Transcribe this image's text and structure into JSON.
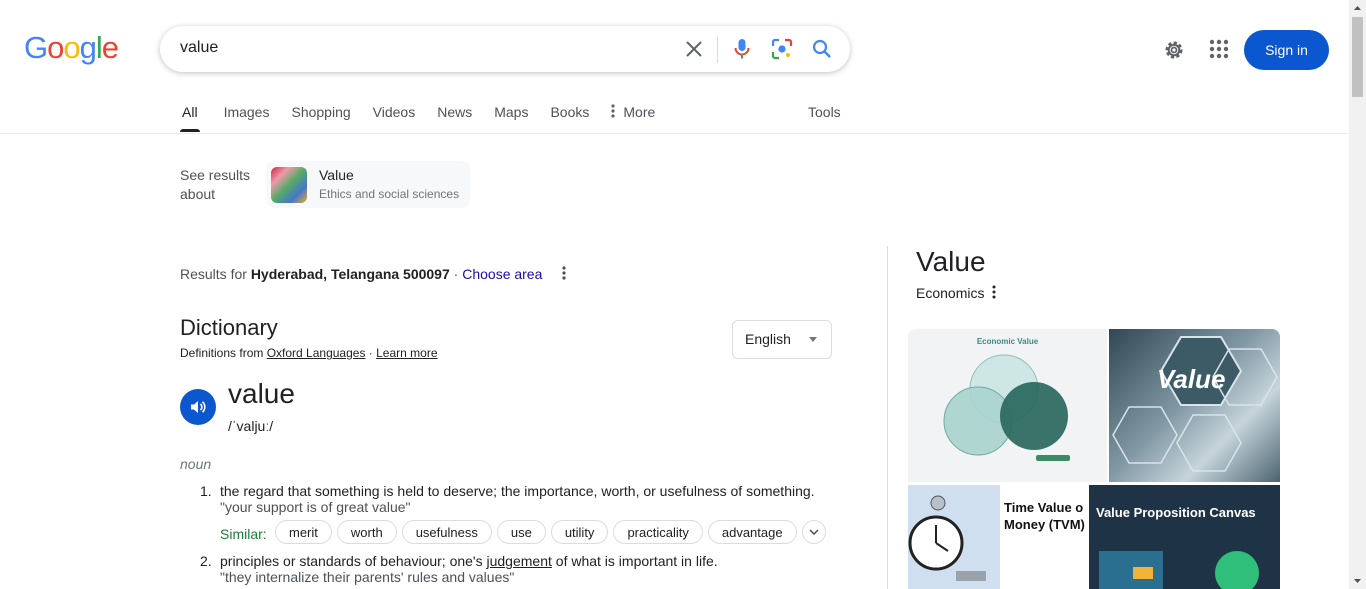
{
  "logo": {
    "letters": [
      "G",
      "o",
      "o",
      "g",
      "l",
      "e"
    ],
    "colors": [
      "#4285f4",
      "#ea4335",
      "#fbbc05",
      "#4285f4",
      "#34a853",
      "#ea4335"
    ]
  },
  "search": {
    "query": "value"
  },
  "header": {
    "signin_label": "Sign in"
  },
  "tabs": [
    {
      "label": "All",
      "active": true
    },
    {
      "label": "Images"
    },
    {
      "label": "Shopping"
    },
    {
      "label": "Videos"
    },
    {
      "label": "News"
    },
    {
      "label": "Maps"
    },
    {
      "label": "Books"
    },
    {
      "label": "More"
    }
  ],
  "tools_label": "Tools",
  "see_results": {
    "label_line1": "See results",
    "label_line2": "about",
    "card_title": "Value",
    "card_subtitle": "Ethics and social sciences"
  },
  "results_for": {
    "prefix": "Results for ",
    "location": "Hyderabad, Telangana 500097",
    "separator": " · ",
    "choose_area": "Choose area"
  },
  "dictionary": {
    "title": "Dictionary",
    "from_prefix": "Definitions from ",
    "source": "Oxford Languages",
    "sep": " · ",
    "learn_more": "Learn more",
    "language": "English",
    "word": "value",
    "phonetic": "/ˈvaljuː/",
    "part_of_speech": "noun",
    "definitions": [
      {
        "num": "1.",
        "text": "the regard that something is held to deserve; the importance, worth, or usefulness of something.",
        "example": "\"your support is of great value\""
      },
      {
        "num": "2.",
        "text_before": "principles or standards of behaviour; one's ",
        "text_link": "judgement",
        "text_after": " of what is important in life.",
        "example": "\"they internalize their parents' rules and values\""
      }
    ],
    "similar_label": "Similar:",
    "similar": [
      "merit",
      "worth",
      "usefulness",
      "use",
      "utility",
      "practicality",
      "advantage"
    ]
  },
  "knowledge_panel": {
    "title": "Value",
    "subtitle": "Economics",
    "images": [
      {
        "caption": "Economic Value"
      },
      {
        "caption": "Value"
      },
      {
        "caption_line1": "Time Value o",
        "caption_line2": "Money (TVM)"
      },
      {
        "caption": "Value Proposition Canvas"
      }
    ]
  },
  "colors": {
    "accent": "#0b57d0",
    "link": "#1a0dab",
    "similar": "#188038"
  }
}
